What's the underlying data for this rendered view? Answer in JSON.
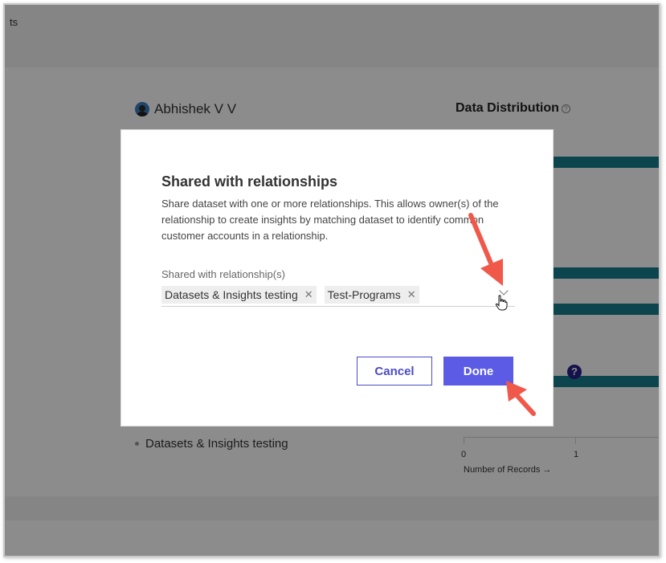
{
  "background": {
    "topbar_text": "ts",
    "owner_name": "Abhishek V V",
    "distribution_title": "Data Distribution",
    "relationship_item": "Datasets & Insights testing",
    "axis_ticks": [
      "0",
      "1"
    ],
    "axis_label": "Number of Records →",
    "help_symbol": "?"
  },
  "modal": {
    "title": "Shared with relationships",
    "description": "Share dataset with one or more relationships. This allows owner(s) of the relationship to create insights by matching dataset to identify common customer accounts in a relationship.",
    "field_label": "Shared with relationship(s)",
    "chips": [
      {
        "label": "Datasets & Insights testing",
        "remove": "✕"
      },
      {
        "label": "Test-Programs",
        "remove": "✕"
      }
    ],
    "cancel_label": "Cancel",
    "done_label": "Done"
  },
  "colors": {
    "accent": "#5b5be6",
    "bar": "#167f8d",
    "annotation_arrow": "#f0584a"
  },
  "icons": {
    "dropdown": "chevron-down-icon",
    "cursor": "hand-pointer-icon",
    "help": "question-circle-icon"
  }
}
